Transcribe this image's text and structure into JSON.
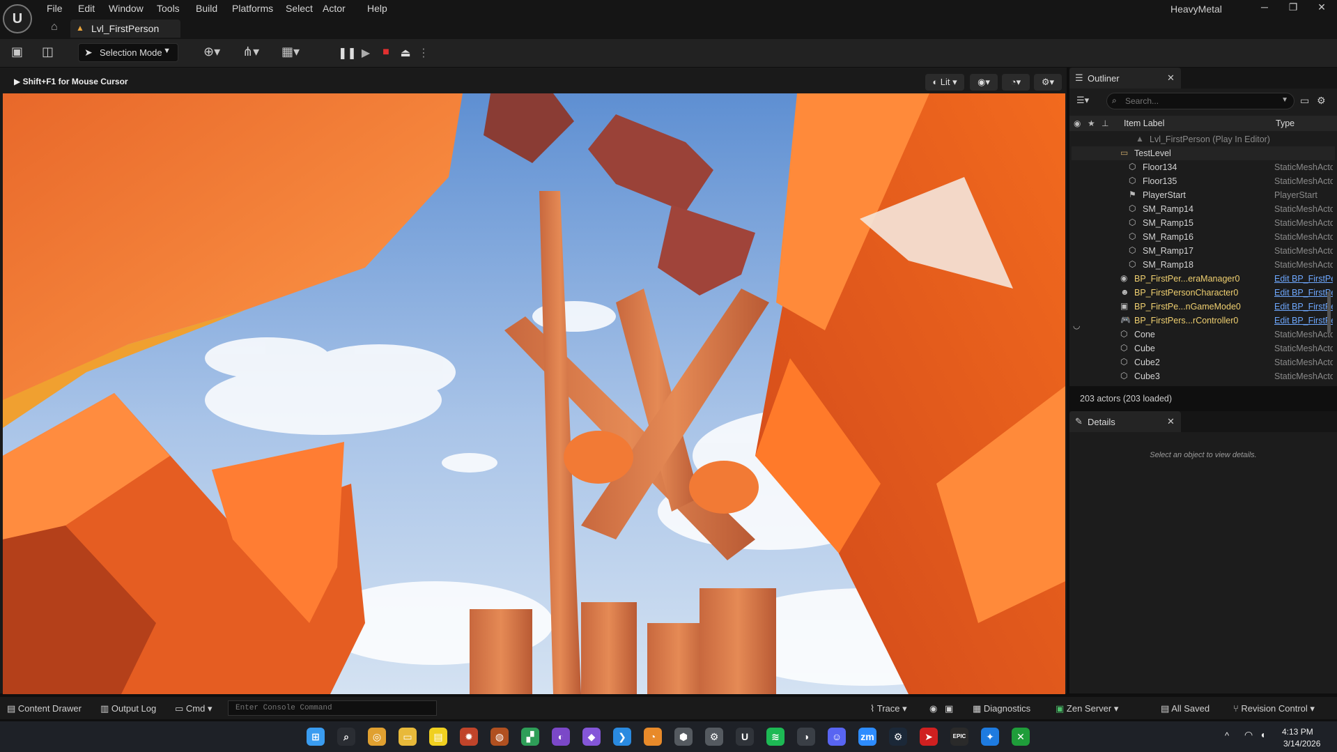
{
  "window": {
    "menu": [
      "File",
      "Edit",
      "Window",
      "Tools",
      "Build",
      "Platforms",
      "Select",
      "Actor",
      "Help"
    ],
    "project": "HeavyMetal",
    "tab_label": "Lvl_FirstPerson",
    "controls": [
      "─",
      "❐",
      "✕"
    ]
  },
  "toolbar": {
    "selection_mode": "Selection Mode"
  },
  "viewport": {
    "hint": "Shift+F1 for Mouse Cursor",
    "lit_label": "Lit",
    "sky_top": "#6f9bd6",
    "sky_bottom": "#c9d9ee",
    "orange_light": "#ff8a3a",
    "orange_dark": "#c8441c"
  },
  "outliner": {
    "title": "Outliner",
    "search_placeholder": "Search...",
    "col_label": "Item Label",
    "col_type": "Type",
    "rows": [
      {
        "indent": 0,
        "icon": "level-icon",
        "glyph": "▲",
        "name": "Lvl_FirstPerson (Play In Editor)",
        "type": "",
        "link": false,
        "dim": true
      },
      {
        "indent": 1,
        "icon": "folder-icon",
        "glyph": "▭",
        "name": "TestLevel",
        "type": "",
        "link": false
      },
      {
        "indent": 2,
        "icon": "mesh-icon",
        "glyph": "⬡",
        "name": "Floor134",
        "type": "StaticMeshActor",
        "link": false
      },
      {
        "indent": 2,
        "icon": "mesh-icon",
        "glyph": "⬡",
        "name": "Floor135",
        "type": "StaticMeshActor",
        "link": false
      },
      {
        "indent": 2,
        "icon": "flag-icon",
        "glyph": "⚑",
        "name": "PlayerStart",
        "type": "PlayerStart",
        "link": false
      },
      {
        "indent": 2,
        "icon": "mesh-icon",
        "glyph": "⬡",
        "name": "SM_Ramp14",
        "type": "StaticMeshActor",
        "link": false
      },
      {
        "indent": 2,
        "icon": "mesh-icon",
        "glyph": "⬡",
        "name": "SM_Ramp15",
        "type": "StaticMeshActor",
        "link": false
      },
      {
        "indent": 2,
        "icon": "mesh-icon",
        "glyph": "⬡",
        "name": "SM_Ramp16",
        "type": "StaticMeshActor",
        "link": false
      },
      {
        "indent": 2,
        "icon": "mesh-icon",
        "glyph": "⬡",
        "name": "SM_Ramp17",
        "type": "StaticMeshActor",
        "link": false
      },
      {
        "indent": 2,
        "icon": "mesh-icon",
        "glyph": "⬡",
        "name": "SM_Ramp18",
        "type": "StaticMeshActor",
        "link": false
      },
      {
        "indent": 1,
        "icon": "camera-manager-icon",
        "glyph": "◉",
        "name": "BP_FirstPer...eraManager0",
        "type": "Edit BP_FirstPersonCameraManager",
        "link": true
      },
      {
        "indent": 1,
        "icon": "character-icon",
        "glyph": "☻",
        "name": "BP_FirstPersonCharacter0",
        "type": "Edit BP_FirstPersonCharacter",
        "link": true
      },
      {
        "indent": 1,
        "icon": "gamemode-icon",
        "glyph": "▣",
        "name": "BP_FirstPe...nGameMode0",
        "type": "Edit BP_FirstPersonGameMode",
        "link": true
      },
      {
        "indent": 1,
        "icon": "controller-icon",
        "glyph": "🎮",
        "name": "BP_FirstPers...rController0",
        "type": "Edit BP_FirstPersonPlayerController",
        "link": true
      },
      {
        "indent": 1,
        "icon": "mesh-icon",
        "glyph": "⬡",
        "name": "Cone",
        "type": "StaticMeshActor",
        "link": false
      },
      {
        "indent": 1,
        "icon": "mesh-icon",
        "glyph": "⬡",
        "name": "Cube",
        "type": "StaticMeshActor",
        "link": false
      },
      {
        "indent": 1,
        "icon": "mesh-icon",
        "glyph": "⬡",
        "name": "Cube2",
        "type": "StaticMeshActor",
        "link": false
      },
      {
        "indent": 1,
        "icon": "mesh-icon",
        "glyph": "⬡",
        "name": "Cube3",
        "type": "StaticMeshActor",
        "link": false
      }
    ],
    "actor_count": "203 actors (203 loaded)"
  },
  "details": {
    "title": "Details",
    "empty_message": "Select an object to view details."
  },
  "statusbar": {
    "content_drawer": "Content Drawer",
    "output_log": "Output Log",
    "cmd": "Cmd",
    "console_placeholder": "Enter Console Command",
    "trace": "Trace",
    "diagnostics": "Diagnostics",
    "zen_server": "Zen Server",
    "all_saved": "All Saved",
    "revision_control": "Revision Control"
  },
  "taskbar": {
    "apps": [
      {
        "name": "windows-start-icon",
        "glyph": "⊞",
        "color": "#3a9cf0"
      },
      {
        "name": "search-icon",
        "glyph": "⌕",
        "color": "#2a2d33"
      },
      {
        "name": "chrome-icon",
        "glyph": "◎",
        "color": "#e0a030"
      },
      {
        "name": "file-explorer-icon",
        "glyph": "▭",
        "color": "#e8b93a"
      },
      {
        "name": "sticky-notes-icon",
        "glyph": "▤",
        "color": "#f0d020"
      },
      {
        "name": "app-icon-a",
        "glyph": "✹",
        "color": "#c0442a"
      },
      {
        "name": "app-icon-b",
        "glyph": "◍",
        "color": "#b05020"
      },
      {
        "name": "app-icon-c",
        "glyph": "▞",
        "color": "#2e9e58"
      },
      {
        "name": "github-icon",
        "glyph": "◐",
        "color": "#7b48c8"
      },
      {
        "name": "visual-studio-icon",
        "glyph": "◆",
        "color": "#8456d8"
      },
      {
        "name": "vscode-icon",
        "glyph": "❯",
        "color": "#2a8ae0"
      },
      {
        "name": "blender-icon",
        "glyph": "◔",
        "color": "#e88a2a"
      },
      {
        "name": "unity-icon",
        "glyph": "⬢",
        "color": "#555a60"
      },
      {
        "name": "settings-cube-icon",
        "glyph": "⚙",
        "color": "#555a60"
      },
      {
        "name": "unreal-icon",
        "glyph": "U",
        "color": "#30343a"
      },
      {
        "name": "spotify-icon",
        "glyph": "≋",
        "color": "#1db954"
      },
      {
        "name": "obs-icon",
        "glyph": "◑",
        "color": "#3a3f46"
      },
      {
        "name": "discord-icon",
        "glyph": "☺",
        "color": "#5865f2"
      },
      {
        "name": "zoom-icon",
        "glyph": "zm",
        "color": "#2d8cff"
      },
      {
        "name": "steam-icon",
        "glyph": "⚙",
        "color": "#1b2838"
      },
      {
        "name": "app-icon-d",
        "glyph": "➤",
        "color": "#d02020"
      },
      {
        "name": "epic-games-icon",
        "glyph": "EPIC",
        "color": "#2a2a2a"
      },
      {
        "name": "app-icon-e",
        "glyph": "✦",
        "color": "#1e7be0"
      },
      {
        "name": "xbox-icon",
        "glyph": "✕",
        "color": "#1f9d3a"
      }
    ],
    "time": "4:13 PM",
    "date": "3/14/2026"
  }
}
